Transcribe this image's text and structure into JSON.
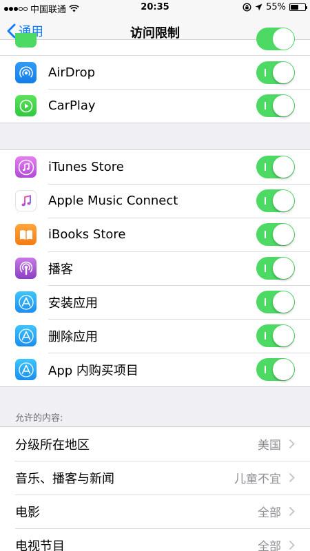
{
  "status_bar": {
    "carrier": "中国联通",
    "time": "20:35",
    "battery": "55%",
    "battery_level": 0.55
  },
  "nav": {
    "back_label": "通用",
    "title": "访问限制"
  },
  "group1": [
    {
      "label": "AirDrop",
      "icon": "airdrop-icon",
      "enabled": true
    },
    {
      "label": "CarPlay",
      "icon": "carplay-icon",
      "enabled": true
    }
  ],
  "group2": [
    {
      "label": "iTunes Store",
      "icon": "itunes-store-icon",
      "enabled": true
    },
    {
      "label": "Apple Music Connect",
      "icon": "apple-music-icon",
      "enabled": true
    },
    {
      "label": "iBooks Store",
      "icon": "ibooks-icon",
      "enabled": true
    },
    {
      "label": "播客",
      "icon": "podcasts-icon",
      "enabled": true
    },
    {
      "label": "安装应用",
      "icon": "app-store-icon",
      "enabled": true
    },
    {
      "label": "删除应用",
      "icon": "app-store-icon",
      "enabled": true
    },
    {
      "label": "App 内购买项目",
      "icon": "app-store-icon",
      "enabled": true
    }
  ],
  "allowed_content": {
    "header": "允许的内容:",
    "rows": [
      {
        "label": "分级所在地区",
        "value": "美国"
      },
      {
        "label": "音乐、播客与新闻",
        "value": "儿童不宜"
      },
      {
        "label": "电影",
        "value": "全部"
      },
      {
        "label": "电视节目",
        "value": "全部"
      }
    ]
  },
  "colors": {
    "toggle_on": "#4cd964",
    "ios_blue": "#0a7aff",
    "background": "#efeff4"
  }
}
